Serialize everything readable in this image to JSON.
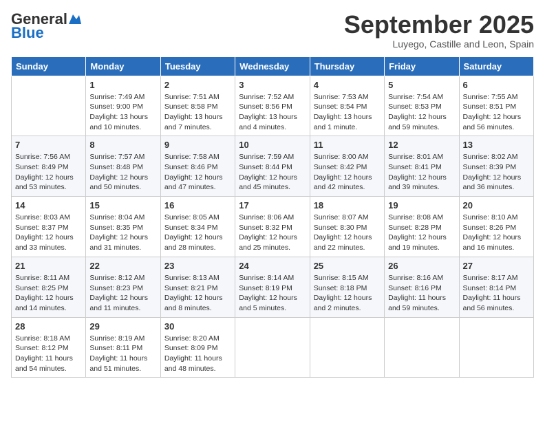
{
  "header": {
    "logo_general": "General",
    "logo_blue": "Blue",
    "month": "September 2025",
    "location": "Luyego, Castille and Leon, Spain"
  },
  "days_of_week": [
    "Sunday",
    "Monday",
    "Tuesday",
    "Wednesday",
    "Thursday",
    "Friday",
    "Saturday"
  ],
  "weeks": [
    [
      {
        "day": "",
        "sunrise": "",
        "sunset": "",
        "daylight": ""
      },
      {
        "day": "1",
        "sunrise": "Sunrise: 7:49 AM",
        "sunset": "Sunset: 9:00 PM",
        "daylight": "Daylight: 13 hours and 10 minutes."
      },
      {
        "day": "2",
        "sunrise": "Sunrise: 7:51 AM",
        "sunset": "Sunset: 8:58 PM",
        "daylight": "Daylight: 13 hours and 7 minutes."
      },
      {
        "day": "3",
        "sunrise": "Sunrise: 7:52 AM",
        "sunset": "Sunset: 8:56 PM",
        "daylight": "Daylight: 13 hours and 4 minutes."
      },
      {
        "day": "4",
        "sunrise": "Sunrise: 7:53 AM",
        "sunset": "Sunset: 8:54 PM",
        "daylight": "Daylight: 13 hours and 1 minute."
      },
      {
        "day": "5",
        "sunrise": "Sunrise: 7:54 AM",
        "sunset": "Sunset: 8:53 PM",
        "daylight": "Daylight: 12 hours and 59 minutes."
      },
      {
        "day": "6",
        "sunrise": "Sunrise: 7:55 AM",
        "sunset": "Sunset: 8:51 PM",
        "daylight": "Daylight: 12 hours and 56 minutes."
      }
    ],
    [
      {
        "day": "7",
        "sunrise": "Sunrise: 7:56 AM",
        "sunset": "Sunset: 8:49 PM",
        "daylight": "Daylight: 12 hours and 53 minutes."
      },
      {
        "day": "8",
        "sunrise": "Sunrise: 7:57 AM",
        "sunset": "Sunset: 8:48 PM",
        "daylight": "Daylight: 12 hours and 50 minutes."
      },
      {
        "day": "9",
        "sunrise": "Sunrise: 7:58 AM",
        "sunset": "Sunset: 8:46 PM",
        "daylight": "Daylight: 12 hours and 47 minutes."
      },
      {
        "day": "10",
        "sunrise": "Sunrise: 7:59 AM",
        "sunset": "Sunset: 8:44 PM",
        "daylight": "Daylight: 12 hours and 45 minutes."
      },
      {
        "day": "11",
        "sunrise": "Sunrise: 8:00 AM",
        "sunset": "Sunset: 8:42 PM",
        "daylight": "Daylight: 12 hours and 42 minutes."
      },
      {
        "day": "12",
        "sunrise": "Sunrise: 8:01 AM",
        "sunset": "Sunset: 8:41 PM",
        "daylight": "Daylight: 12 hours and 39 minutes."
      },
      {
        "day": "13",
        "sunrise": "Sunrise: 8:02 AM",
        "sunset": "Sunset: 8:39 PM",
        "daylight": "Daylight: 12 hours and 36 minutes."
      }
    ],
    [
      {
        "day": "14",
        "sunrise": "Sunrise: 8:03 AM",
        "sunset": "Sunset: 8:37 PM",
        "daylight": "Daylight: 12 hours and 33 minutes."
      },
      {
        "day": "15",
        "sunrise": "Sunrise: 8:04 AM",
        "sunset": "Sunset: 8:35 PM",
        "daylight": "Daylight: 12 hours and 31 minutes."
      },
      {
        "day": "16",
        "sunrise": "Sunrise: 8:05 AM",
        "sunset": "Sunset: 8:34 PM",
        "daylight": "Daylight: 12 hours and 28 minutes."
      },
      {
        "day": "17",
        "sunrise": "Sunrise: 8:06 AM",
        "sunset": "Sunset: 8:32 PM",
        "daylight": "Daylight: 12 hours and 25 minutes."
      },
      {
        "day": "18",
        "sunrise": "Sunrise: 8:07 AM",
        "sunset": "Sunset: 8:30 PM",
        "daylight": "Daylight: 12 hours and 22 minutes."
      },
      {
        "day": "19",
        "sunrise": "Sunrise: 8:08 AM",
        "sunset": "Sunset: 8:28 PM",
        "daylight": "Daylight: 12 hours and 19 minutes."
      },
      {
        "day": "20",
        "sunrise": "Sunrise: 8:10 AM",
        "sunset": "Sunset: 8:26 PM",
        "daylight": "Daylight: 12 hours and 16 minutes."
      }
    ],
    [
      {
        "day": "21",
        "sunrise": "Sunrise: 8:11 AM",
        "sunset": "Sunset: 8:25 PM",
        "daylight": "Daylight: 12 hours and 14 minutes."
      },
      {
        "day": "22",
        "sunrise": "Sunrise: 8:12 AM",
        "sunset": "Sunset: 8:23 PM",
        "daylight": "Daylight: 12 hours and 11 minutes."
      },
      {
        "day": "23",
        "sunrise": "Sunrise: 8:13 AM",
        "sunset": "Sunset: 8:21 PM",
        "daylight": "Daylight: 12 hours and 8 minutes."
      },
      {
        "day": "24",
        "sunrise": "Sunrise: 8:14 AM",
        "sunset": "Sunset: 8:19 PM",
        "daylight": "Daylight: 12 hours and 5 minutes."
      },
      {
        "day": "25",
        "sunrise": "Sunrise: 8:15 AM",
        "sunset": "Sunset: 8:18 PM",
        "daylight": "Daylight: 12 hours and 2 minutes."
      },
      {
        "day": "26",
        "sunrise": "Sunrise: 8:16 AM",
        "sunset": "Sunset: 8:16 PM",
        "daylight": "Daylight: 11 hours and 59 minutes."
      },
      {
        "day": "27",
        "sunrise": "Sunrise: 8:17 AM",
        "sunset": "Sunset: 8:14 PM",
        "daylight": "Daylight: 11 hours and 56 minutes."
      }
    ],
    [
      {
        "day": "28",
        "sunrise": "Sunrise: 8:18 AM",
        "sunset": "Sunset: 8:12 PM",
        "daylight": "Daylight: 11 hours and 54 minutes."
      },
      {
        "day": "29",
        "sunrise": "Sunrise: 8:19 AM",
        "sunset": "Sunset: 8:11 PM",
        "daylight": "Daylight: 11 hours and 51 minutes."
      },
      {
        "day": "30",
        "sunrise": "Sunrise: 8:20 AM",
        "sunset": "Sunset: 8:09 PM",
        "daylight": "Daylight: 11 hours and 48 minutes."
      },
      {
        "day": "",
        "sunrise": "",
        "sunset": "",
        "daylight": ""
      },
      {
        "day": "",
        "sunrise": "",
        "sunset": "",
        "daylight": ""
      },
      {
        "day": "",
        "sunrise": "",
        "sunset": "",
        "daylight": ""
      },
      {
        "day": "",
        "sunrise": "",
        "sunset": "",
        "daylight": ""
      }
    ]
  ]
}
